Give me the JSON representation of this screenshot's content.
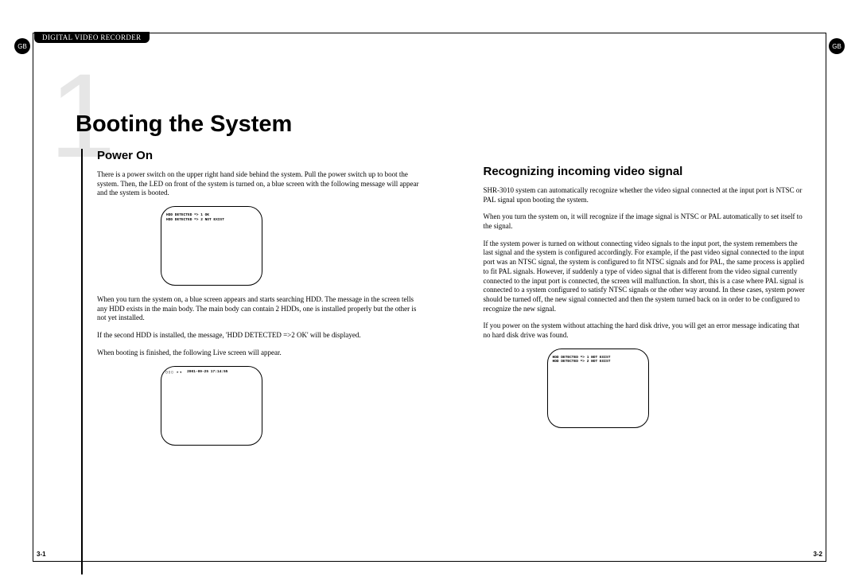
{
  "header": {
    "tab": "DIGITAL VIDEO RECORDER",
    "gb": "GB",
    "chapter_number": "1",
    "chapter_title": "Booting the System"
  },
  "left": {
    "heading": "Power On",
    "p1": "There is a power switch on the upper right hand side behind the system. Pull the power switch up to boot the system. Then, the LED on front of the system is turned on, a blue screen with the following message will appear and the system is booted.",
    "screen1_line1": "HDD DETECTED => 1 OK",
    "screen1_line2": "HDD DETECTED => 2 NOT EXIST",
    "p2": "When you turn the system on, a blue screen appears and starts searching HDD. The message in the screen tells any HDD exists in the main body. The main body can contain 2 HDDs, one is installed properly but the other is not yet installed.",
    "p3": "If the second HDD is installed, the message, 'HDD DETECTED =>2 OK' will be displayed.",
    "p4": "When booting is finished, the following Live screen will appear.",
    "screen2_icons": "◯▯▯ ▸◂",
    "screen2_text": "2001-09-25 17:14:55"
  },
  "right": {
    "heading": "Recognizing incoming video signal",
    "p1": "SHR-3010 system can automatically recognize whether the video signal connected at the input port is NTSC or PAL signal upon booting the system.",
    "p2": "When you turn the system on, it will recognize if the image signal is NTSC or PAL automatically to set itself to the signal.",
    "p3": "If the system power is turned on without connecting video signals to the input port, the system remembers the last signal and the system is configured accordingly. For example, if the past video signal connected to the input port was an NTSC signal, the system is configured to fit NTSC signals and for PAL, the same process is applied to fit PAL signals. However, if suddenly a type of video signal that is different from the video signal currently connected to the input port is connected, the screen will malfunction. In short, this is a case where PAL signal is connected to a system configured to satisfy NTSC signals or the other way around. In these cases, system power should be turned off, the new signal connected and then the system turned back on in order to be configured to recognize the new signal.",
    "p4": "If you power on the system without attaching the hard disk drive, you will get an error message indicating that no hard disk drive was found.",
    "screen_line1": "HDD DETECTED => 1 NOT EXIST",
    "screen_line2": "HDD DETECTED => 2 NOT EXIST"
  },
  "page": {
    "left": "3-1",
    "right": "3-2"
  }
}
